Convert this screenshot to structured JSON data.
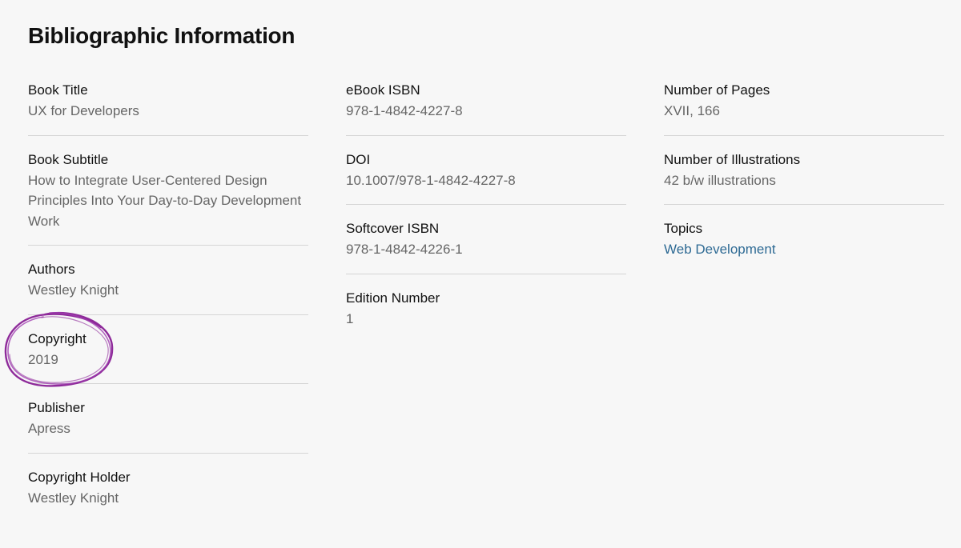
{
  "section": {
    "title": "Bibliographic Information"
  },
  "columns": [
    {
      "items": [
        {
          "label": "Book Title",
          "value": "UX for Developers"
        },
        {
          "label": "Book Subtitle",
          "value": "How to Integrate User-Centered Design Principles Into Your Day-to-Day Development Work"
        },
        {
          "label": "Authors",
          "value": "Westley Knight"
        },
        {
          "label": "Copyright",
          "value": "2019"
        },
        {
          "label": "Publisher",
          "value": "Apress"
        },
        {
          "label": "Copyright Holder",
          "value": "Westley Knight"
        }
      ]
    },
    {
      "items": [
        {
          "label": "eBook ISBN",
          "value": "978-1-4842-4227-8"
        },
        {
          "label": "DOI",
          "value": "10.1007/978-1-4842-4227-8"
        },
        {
          "label": "Softcover ISBN",
          "value": "978-1-4842-4226-1"
        },
        {
          "label": "Edition Number",
          "value": "1"
        }
      ]
    },
    {
      "items": [
        {
          "label": "Number of Pages",
          "value": "XVII, 166"
        },
        {
          "label": "Number of Illustrations",
          "value": "42 b/w illustrations"
        },
        {
          "label": "Topics",
          "value": "Web Development"
        }
      ]
    }
  ],
  "colors": {
    "background": "#f7f7f7",
    "label": "#111111",
    "value": "#666666",
    "link": "#2e6a94",
    "annotation": "#8e2a9a"
  }
}
